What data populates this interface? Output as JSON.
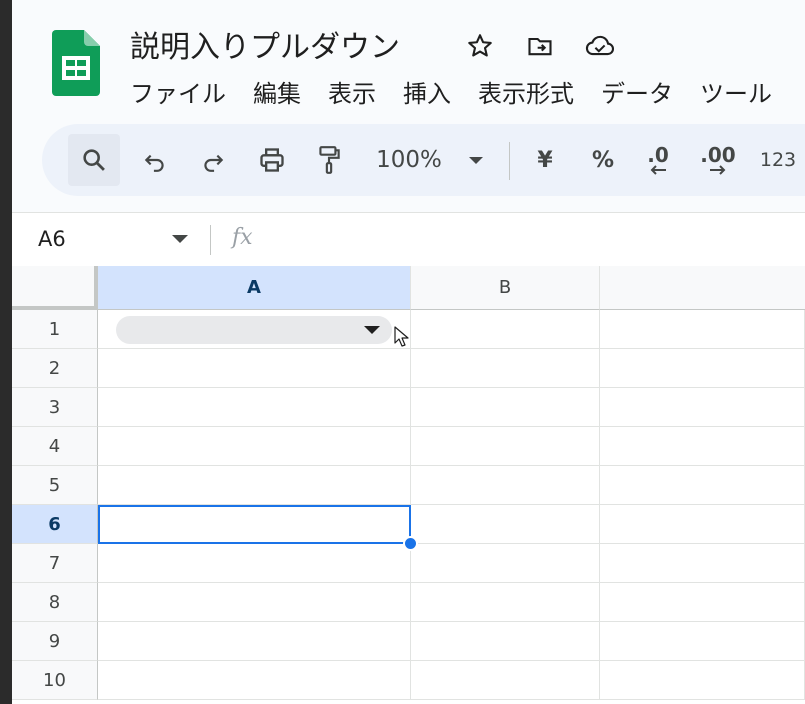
{
  "document": {
    "title": "説明入りプルダウン",
    "star_icon": "star-icon",
    "move_icon": "move-folder-icon",
    "cloud_icon": "cloud-saved-icon"
  },
  "menu": [
    "ファイル",
    "編集",
    "表示",
    "挿入",
    "表示形式",
    "データ",
    "ツール"
  ],
  "toolbar": {
    "zoom": "100%",
    "currency": "¥",
    "percent": "%",
    "decrease_decimal": ".0",
    "increase_decimal": ".00",
    "number_format": "123"
  },
  "formula_bar": {
    "name_box": "A6",
    "fx_label": "fx",
    "value": ""
  },
  "grid": {
    "columns": [
      "A",
      "B"
    ],
    "rows": [
      "1",
      "2",
      "3",
      "4",
      "5",
      "6",
      "7",
      "8",
      "9",
      "10"
    ],
    "selected_column": "A",
    "selected_row": "6",
    "A1_dropdown_value": ""
  },
  "colors": {
    "sheets_green": "#0f9d58",
    "selection_blue": "#1a73e8",
    "header_selected": "#d3e3fd"
  }
}
